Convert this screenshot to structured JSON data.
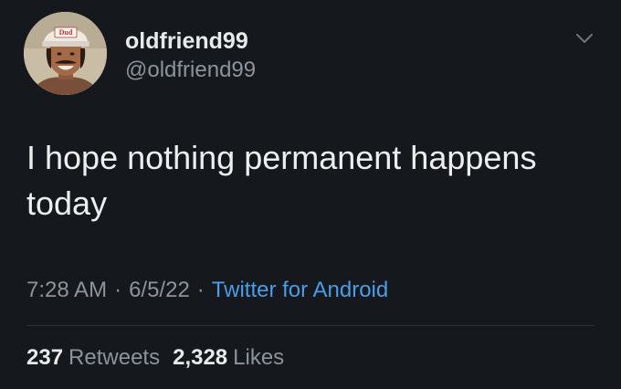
{
  "user": {
    "display_name": "oldfriend99",
    "handle": "@oldfriend99",
    "avatar_hat_text": "Dud"
  },
  "tweet": {
    "text": "I hope nothing permanent happens\ntoday",
    "time": "7:28 AM",
    "date": "6/5/22",
    "separator": "·",
    "source": "Twitter for Android"
  },
  "stats": {
    "retweets_count": "237",
    "retweets_label": "Retweets",
    "likes_count": "2,328",
    "likes_label": "Likes"
  },
  "icons": {
    "more": "chevron-down-icon"
  },
  "colors": {
    "background": "#15181d",
    "text": "#e7e9ea",
    "secondary": "#8b949c",
    "link": "#4a9de6"
  }
}
